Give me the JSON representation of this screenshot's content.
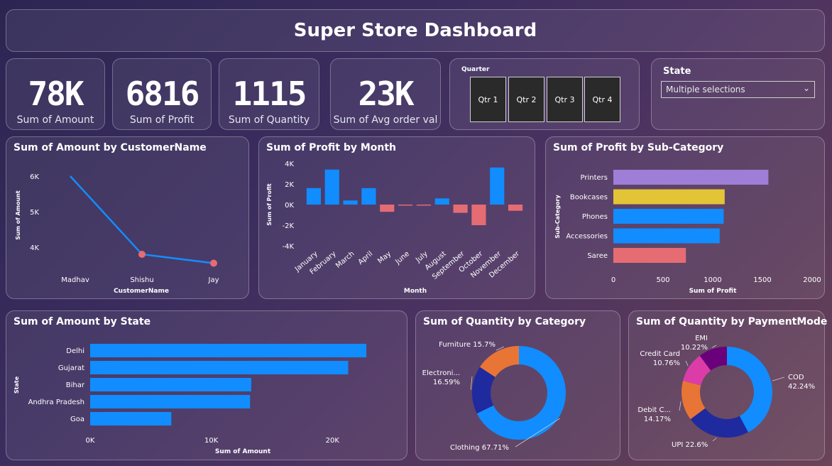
{
  "title": "Super Store Dashboard",
  "kpis": [
    {
      "value": "78K",
      "label": "Sum of Amount"
    },
    {
      "value": "6816",
      "label": "Sum of Profit"
    },
    {
      "value": "1115",
      "label": "Sum of Quantity"
    },
    {
      "value": "23K",
      "label": "Sum of Avg order val"
    }
  ],
  "quarter_slicer": {
    "header": "Quarter",
    "buttons": [
      "Qtr 1",
      "Qtr 2",
      "Qtr 3",
      "Qtr 4"
    ]
  },
  "state_slicer": {
    "header": "State",
    "value": "Multiple selections"
  },
  "colors": {
    "blue": "#118dff",
    "salmon": "#e66c74",
    "purple": "#9e7ed6",
    "yellow": "#e3c436",
    "orange": "#e87535",
    "navy": "#1f2a9e",
    "pink": "#dc3ca8",
    "darkpurple": "#6b007b"
  },
  "chart_data": [
    {
      "type": "line",
      "title": "Sum of Amount by CustomerName",
      "xlabel": "CustomerName",
      "ylabel": "Sum of Amount",
      "categories": [
        "Madhav",
        "Shishu",
        "Jay"
      ],
      "values": [
        6000,
        3800,
        3550
      ],
      "yticks": [
        "4K",
        "5K",
        "6K"
      ],
      "yticks_values": [
        4000,
        5000,
        6000
      ],
      "ylim": [
        3300,
        6300
      ]
    },
    {
      "type": "bar",
      "title": "Sum of Profit by Month",
      "xlabel": "Month",
      "ylabel": "Sum of Profit",
      "categories": [
        "January",
        "February",
        "March",
        "April",
        "May",
        "June",
        "July",
        "August",
        "September",
        "October",
        "November",
        "December"
      ],
      "values": [
        1600,
        3400,
        400,
        1600,
        -700,
        -100,
        -100,
        600,
        -800,
        -2000,
        3600,
        -600
      ],
      "yticks": [
        "-4K",
        "-2K",
        "0K",
        "2K",
        "4K"
      ],
      "yticks_values": [
        -4000,
        -2000,
        0,
        2000,
        4000
      ],
      "ylim": [
        -4000,
        4000
      ]
    },
    {
      "type": "bar",
      "orientation": "horizontal",
      "title": "Sum of Profit by Sub-Category",
      "xlabel": "Sum of Profit",
      "ylabel": "Sub-Category",
      "categories": [
        "Printers",
        "Bookcases",
        "Phones",
        "Accessories",
        "Saree"
      ],
      "values": [
        1560,
        1120,
        1110,
        1070,
        730
      ],
      "xticks": [
        "0",
        "500",
        "1000",
        "1500",
        "2000"
      ],
      "xticks_values": [
        0,
        500,
        1000,
        1500,
        2000
      ],
      "xlim": [
        0,
        2000
      ]
    },
    {
      "type": "bar",
      "orientation": "horizontal",
      "title": "Sum of Amount by State",
      "xlabel": "Sum of Amount",
      "ylabel": "State",
      "categories": [
        "Delhi",
        "Gujarat",
        "Bihar",
        "Andhra Pradesh",
        "Goa"
      ],
      "values": [
        22800,
        21300,
        13300,
        13200,
        6700
      ],
      "xticks": [
        "0K",
        "10K",
        "20K"
      ],
      "xticks_values": [
        0,
        10000,
        20000
      ],
      "xlim": [
        0,
        23500
      ]
    },
    {
      "type": "pie",
      "title": "Sum of Quantity by Category",
      "labels": [
        "Clothing",
        "Electronics",
        "Furniture"
      ],
      "display_labels": [
        "Clothing 67.71%",
        "Electroni...",
        "Furniture 15.7%"
      ],
      "display_labels_2": [
        "",
        "16.59%",
        ""
      ],
      "values": [
        67.71,
        16.59,
        15.7
      ]
    },
    {
      "type": "pie",
      "title": "Sum of Quantity by PaymentMode",
      "labels": [
        "COD",
        "UPI",
        "Debit Card",
        "Credit Card",
        "EMI"
      ],
      "display_labels": [
        "COD",
        "UPI 22.6%",
        "Debit C...",
        "Credit Card",
        "EMI"
      ],
      "display_labels_2": [
        "42.24%",
        "",
        "14.17%",
        "10.76%",
        "10.22%"
      ],
      "values": [
        42.24,
        22.6,
        14.17,
        10.76,
        10.22
      ]
    }
  ]
}
